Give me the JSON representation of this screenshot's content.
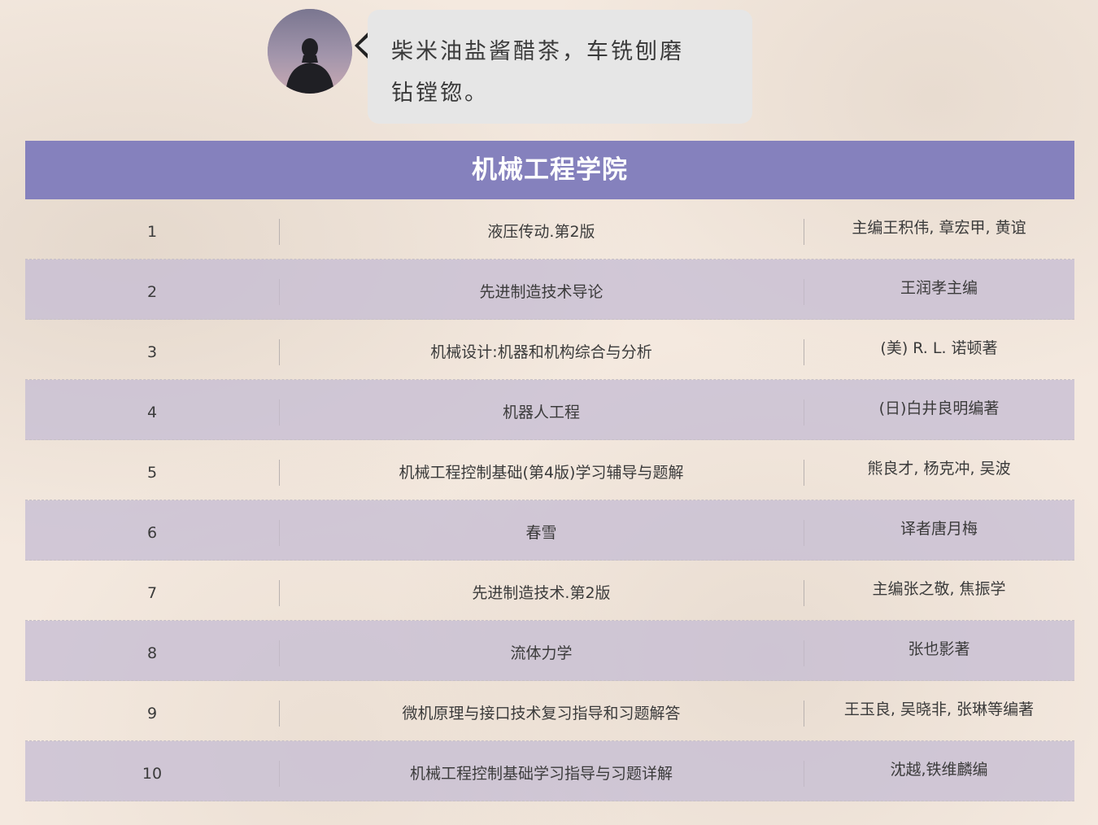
{
  "bubble": {
    "line1": "柴米油盐酱醋茶，车铣刨磨",
    "line2": "钻镗锪。"
  },
  "table": {
    "title": "机械工程学院",
    "rows": [
      {
        "index": "1",
        "title": "液压传动.第2版",
        "author": "主编王积伟, 章宏甲, 黄谊"
      },
      {
        "index": "2",
        "title": "先进制造技术导论",
        "author": "王润孝主编"
      },
      {
        "index": "3",
        "title": "机械设计:机器和机构综合与分析",
        "author": "(美) R. L. 诺顿著"
      },
      {
        "index": "4",
        "title": "机器人工程",
        "author": "(日)白井良明编著"
      },
      {
        "index": "5",
        "title": "机械工程控制基础(第4版)学习辅导与题解",
        "author": "熊良才, 杨克冲, 吴波"
      },
      {
        "index": "6",
        "title": "春雪",
        "author": "译者唐月梅"
      },
      {
        "index": "7",
        "title": "先进制造技术.第2版",
        "author": "主编张之敬, 焦振学"
      },
      {
        "index": "8",
        "title": "流体力学",
        "author": "张也影著"
      },
      {
        "index": "9",
        "title": "微机原理与接口技术复习指导和习题解答",
        "author": "王玉良, 吴晓非, 张琳等编著"
      },
      {
        "index": "10",
        "title": "机械工程控制基础学习指导与习题详解",
        "author": "沈越,铁维麟编"
      }
    ]
  },
  "colors": {
    "page_background": "#f4e9df",
    "title_bar": "#8581bd",
    "alt_row": "#c7bed4",
    "bubble": "#e6e6e6"
  },
  "icons": {
    "avatar": "person-silhouette-avatar"
  }
}
